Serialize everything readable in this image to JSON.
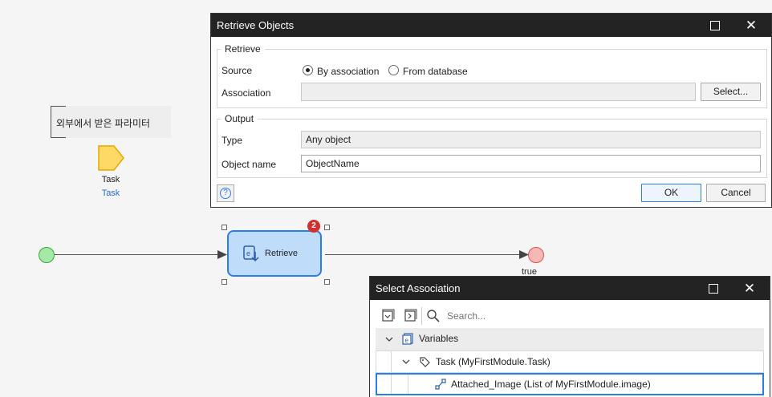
{
  "canvas": {
    "annotation_text": "외부에서 받은 파라미터",
    "parameter": {
      "name": "Task",
      "type": "Task"
    },
    "activity": {
      "label": "Retrieve",
      "error_count": "2"
    },
    "end_event_label": "true"
  },
  "retrieve_dialog": {
    "title": "Retrieve Objects",
    "retrieve_group": "Retrieve",
    "source_label": "Source",
    "option_association": "By association",
    "option_database": "From database",
    "association_label": "Association",
    "association_value": "",
    "select_button": "Select...",
    "output_group": "Output",
    "type_label": "Type",
    "type_value": "Any object",
    "object_name_label": "Object name",
    "object_name_value": "ObjectName",
    "ok_button": "OK",
    "cancel_button": "Cancel"
  },
  "association_dialog": {
    "title": "Select Association",
    "search_placeholder": "Search...",
    "tree": [
      {
        "label": "Variables",
        "icon": "variables-icon"
      },
      {
        "label": "Task (MyFirstModule.Task)",
        "icon": "entity-tag-icon"
      },
      {
        "label": "Attached_Image (List of MyFirstModule.image)",
        "icon": "association-icon"
      }
    ]
  },
  "colors": {
    "accent": "#2b7de9",
    "titlebar": "#232323",
    "start_event": "#a6e8a6",
    "end_event": "#f6b7b7",
    "activity_fill": "#bfdcfb",
    "badge": "#d32f2f",
    "parameter_fill": "#ffd966"
  }
}
